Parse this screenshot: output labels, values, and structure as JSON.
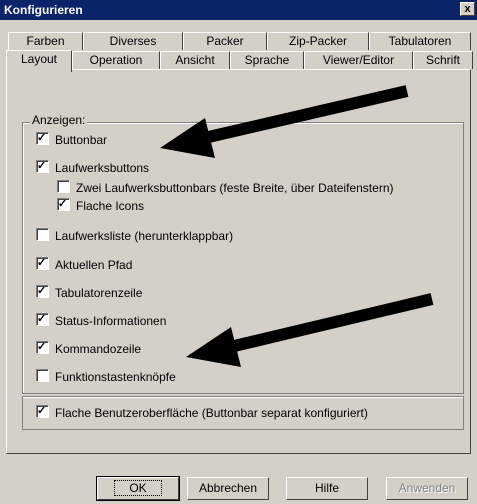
{
  "window": {
    "title": "Konfigurieren",
    "close_glyph": "x"
  },
  "tabs_row1": [
    "Farben",
    "Diverses",
    "Packer",
    "Zip-Packer",
    "Tabulatoren"
  ],
  "tabs_row2": [
    "Layout",
    "Operation",
    "Ansicht",
    "Sprache",
    "Viewer/Editor",
    "Schrift"
  ],
  "active_tab": "Layout",
  "group": {
    "label": "Anzeigen:"
  },
  "options": {
    "buttonbar": {
      "label": "Buttonbar",
      "checked": true
    },
    "laufwerksbuttons": {
      "label": "Laufwerksbuttons",
      "checked": true
    },
    "zwei_laufwerksbuttonbars": {
      "label": "Zwei Laufwerksbuttonbars (feste Breite, über Dateifenstern)",
      "checked": false
    },
    "flache_icons": {
      "label": "Flache Icons",
      "checked": true
    },
    "laufwerksliste": {
      "label": "Laufwerksliste (herunterklappbar)",
      "checked": false
    },
    "aktuellen_pfad": {
      "label": "Aktuellen Pfad",
      "checked": true
    },
    "tabulatorenzeile": {
      "label": "Tabulatorenzeile",
      "checked": true
    },
    "status_informationen": {
      "label": "Status-Informationen",
      "checked": true
    },
    "kommandozeile": {
      "label": "Kommandozeile",
      "checked": true
    },
    "funktionstastenknoepfe": {
      "label": "Funktionstastenknöpfe",
      "checked": false
    },
    "flache_benutzeroberflaeche": {
      "label": "Flache Benutzeroberfläche (Buttonbar separat konfiguriert)",
      "checked": true
    }
  },
  "buttons": {
    "ok": "OK",
    "abbrechen": "Abbrechen",
    "hilfe": "Hilfe",
    "anwenden": "Anwenden"
  },
  "colors": {
    "titlebar": "#0a246a",
    "face": "#d4d0c8",
    "arrow": "#000000"
  }
}
